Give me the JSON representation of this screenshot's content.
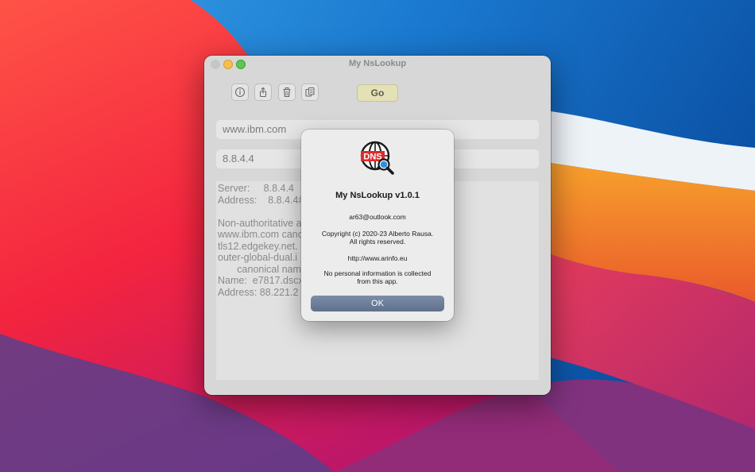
{
  "window": {
    "title": "My NsLookup"
  },
  "toolbar": {
    "go_label": "Go",
    "icons": [
      "info-icon",
      "share-icon",
      "trash-icon",
      "copy-icon"
    ]
  },
  "domain_field": {
    "value": "www.ibm.com"
  },
  "server_field": {
    "value": "8.8.4.4"
  },
  "result": {
    "lines": [
      "Server:     8.8.4.4",
      "Address:    8.8.4.4#",
      "",
      "Non-authoritative a",
      "www.ibm.com canc                                    mcom-",
      "tls12.edgekey.net.",
      "outer-global-dual.i",
      "       canonical name",
      "Name:  e7817.dscx",
      "Address: 88.221.2"
    ]
  },
  "about_dialog": {
    "title": "My NsLookup v1.0.1",
    "email": "ar63@outlook.com",
    "copyright_line1": "Copyright (c) 2020-23 Alberto Rausa.",
    "copyright_line2": "All rights reserved.",
    "url": "http://www.arinfo.eu",
    "note_line1": "No personal information is collected",
    "note_line2": "from this app.",
    "ok_label": "OK",
    "icon_text": "DNS"
  },
  "colors": {
    "accent_red": "#e02a2a",
    "ok_button": "#6a7c97",
    "go_button": "#e4e1b6"
  }
}
